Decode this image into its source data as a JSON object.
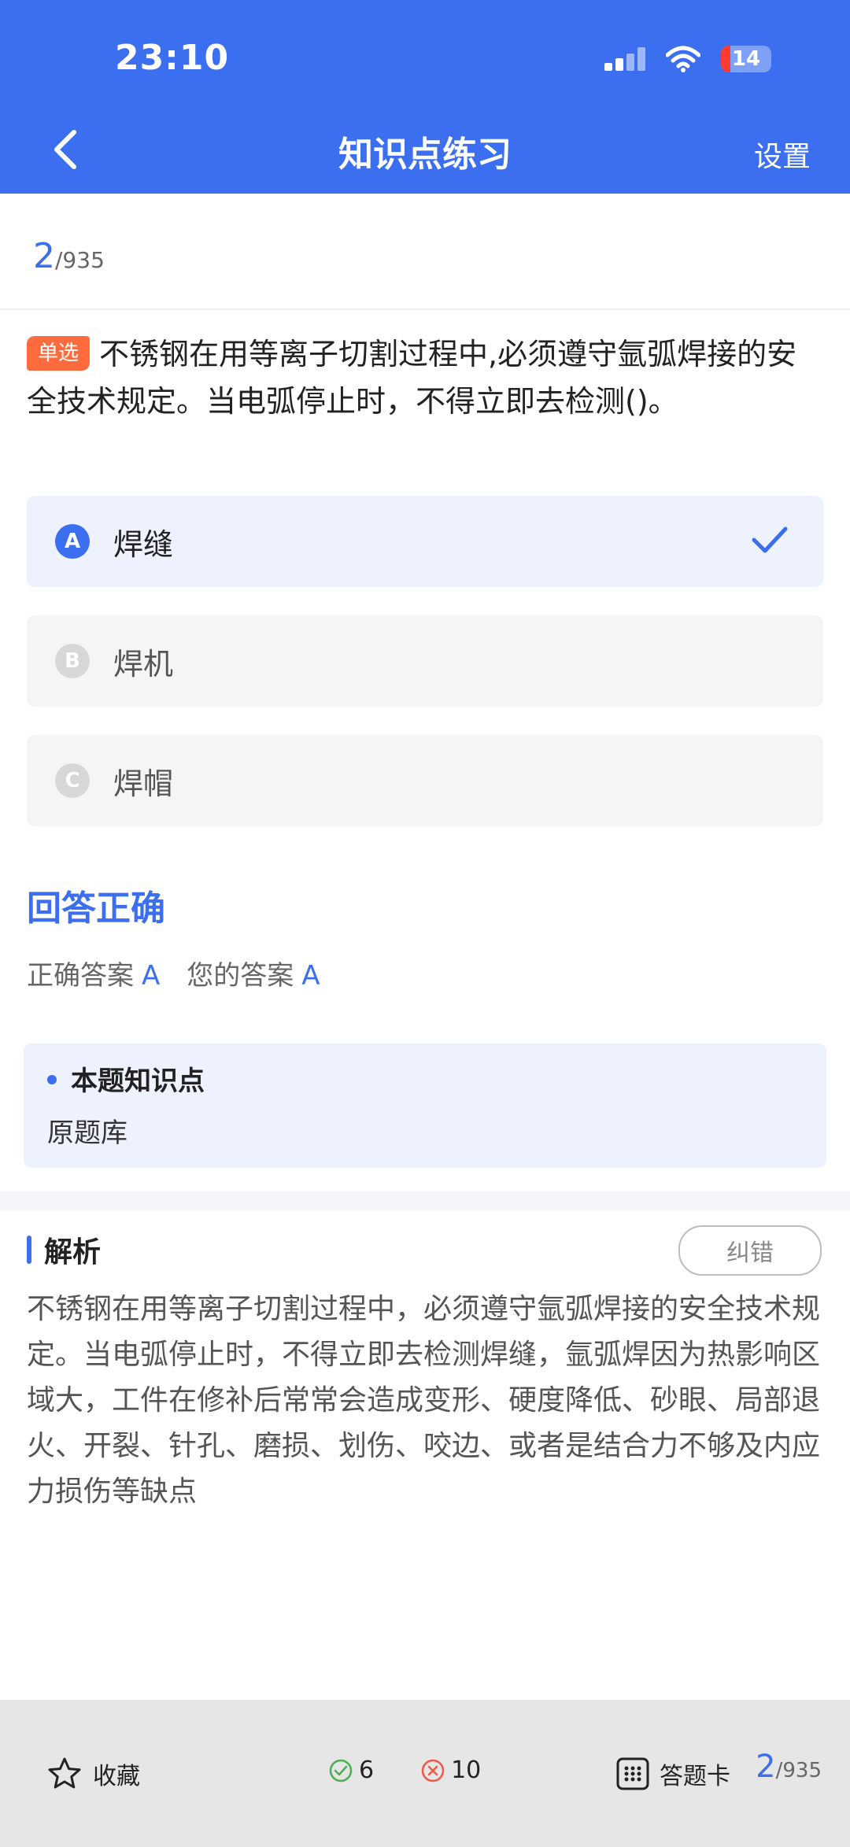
{
  "status": {
    "time": "23:10",
    "battery": "14"
  },
  "header": {
    "title": "知识点练习",
    "settings_label": "设置"
  },
  "progress": {
    "current": "2",
    "total": "/935"
  },
  "question": {
    "type_tag": "单选",
    "text": "不锈钢在用等离子切割过程中,必须遵守氩弧焊接的安全技术规定。当电弧停止时，不得立即去检测()。"
  },
  "options": [
    {
      "letter": "A",
      "text": "焊缝",
      "selected": true
    },
    {
      "letter": "B",
      "text": "焊机",
      "selected": false
    },
    {
      "letter": "C",
      "text": "焊帽",
      "selected": false
    }
  ],
  "result": {
    "title": "回答正确",
    "correct_label": "正确答案",
    "correct_value": "A",
    "your_label": "您的答案",
    "your_value": "A"
  },
  "knowledge_point": {
    "title": "本题知识点",
    "text": "原题库"
  },
  "analysis": {
    "title": "解析",
    "report_label": "纠错",
    "text": "不锈钢在用等离子切割过程中，必须遵守氩弧焊接的安全技术规定。当电弧停止时，不得立即去检测焊缝，氩弧焊因为热影响区域大，工件在修补后常常会造成变形、硬度降低、砂眼、局部退火、开裂、针孔、磨损、划伤、咬边、或者是结合力不够及内应力损伤等缺点"
  },
  "bottom_bar": {
    "favorite_label": "收藏",
    "correct_count": "6",
    "wrong_count": "10",
    "answer_card_label": "答题卡",
    "progress_current": "2",
    "progress_total": "/935"
  },
  "colors": {
    "accent": "#3b6ff0",
    "tag": "#ff6b3d",
    "correct": "#4caf50",
    "wrong": "#f05a4a"
  }
}
